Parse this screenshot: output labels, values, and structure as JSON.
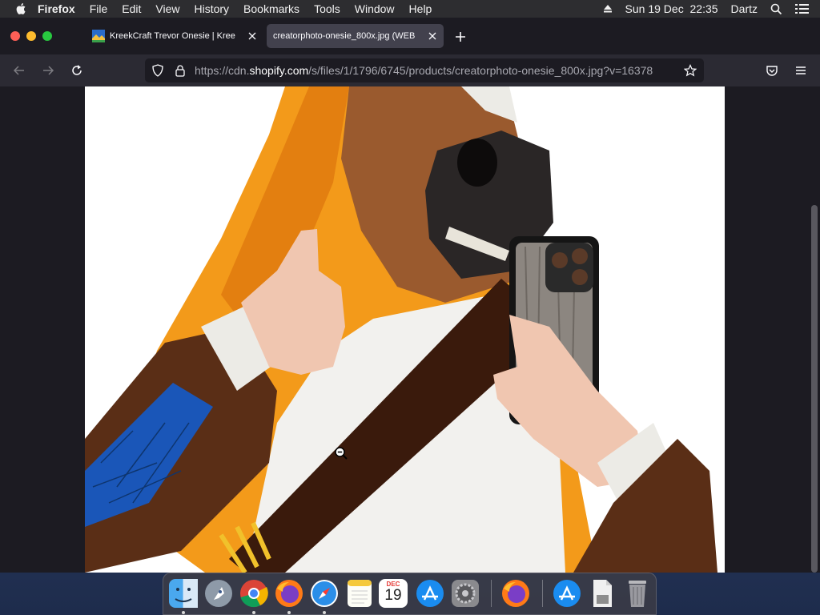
{
  "menubar": {
    "app": "Firefox",
    "items": [
      "File",
      "Edit",
      "View",
      "History",
      "Bookmarks",
      "Tools",
      "Window",
      "Help"
    ],
    "date": "Sun 19 Dec",
    "time": "22:35",
    "user": "Dartz"
  },
  "tabs": [
    {
      "title": "KreekCraft Trevor Onesie | Kree",
      "active": false
    },
    {
      "title": "creatorphoto-onesie_800x.jpg (WEB",
      "active": true
    }
  ],
  "url": {
    "prefix": "https://cdn.",
    "host": "shopify.com",
    "path": "/s/files/1/1796/6745/products/creatorphoto-onesie_800x.jpg?v=16378"
  },
  "dock": {
    "calendar_month": "DEC",
    "calendar_day": "19",
    "apps": [
      "finder-icon",
      "launchpad-icon",
      "chrome-icon",
      "firefox-icon",
      "safari-icon",
      "notes-icon",
      "calendar-icon",
      "app-store-icon",
      "system-preferences-icon",
      "firefox-icon",
      "downloads-icon",
      "file-icon",
      "trash-icon"
    ]
  },
  "colors": {
    "accent_orange": "#f39a1a",
    "hood_brown": "#5a2e16",
    "strap_brown": "#3a1a0c",
    "sleeve_blue": "#1a56b8"
  }
}
